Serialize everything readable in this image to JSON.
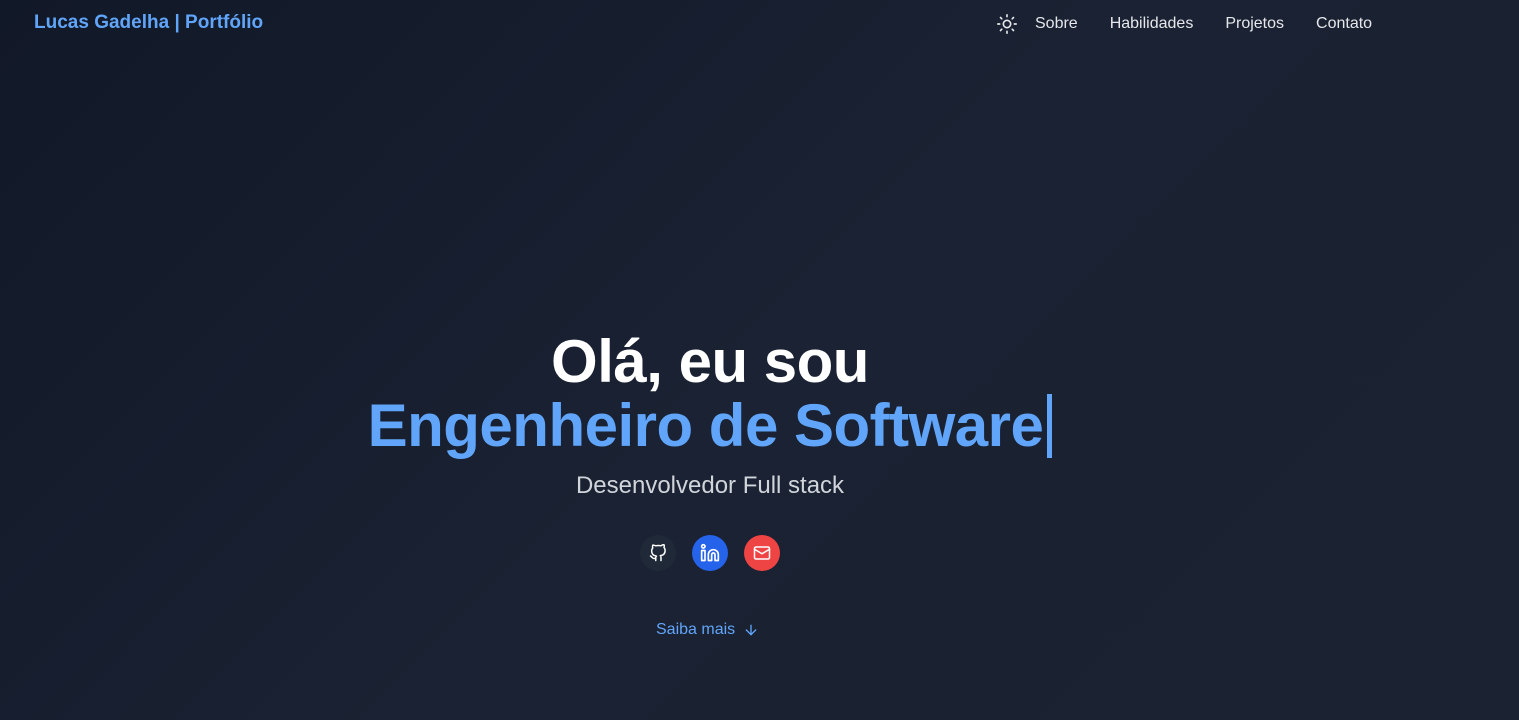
{
  "header": {
    "brand": "Lucas Gadelha | Portfólio",
    "theme_toggle_icon": "sun-icon",
    "nav": [
      {
        "label": "Sobre"
      },
      {
        "label": "Habilidades"
      },
      {
        "label": "Projetos"
      },
      {
        "label": "Contato"
      }
    ]
  },
  "hero": {
    "greeting": "Olá, eu sou",
    "role": "Engenheiro de Software",
    "subtitle": "Desenvolvedor Full stack",
    "socials": [
      {
        "icon": "github-icon",
        "color": "#1f2937"
      },
      {
        "icon": "linkedin-icon",
        "color": "#2563eb"
      },
      {
        "icon": "mail-icon",
        "color": "#ef4444"
      }
    ],
    "learn_more": "Saiba mais",
    "learn_more_icon": "arrow-down-icon"
  },
  "colors": {
    "accent": "#60a5fa",
    "background": "#161e2e"
  }
}
